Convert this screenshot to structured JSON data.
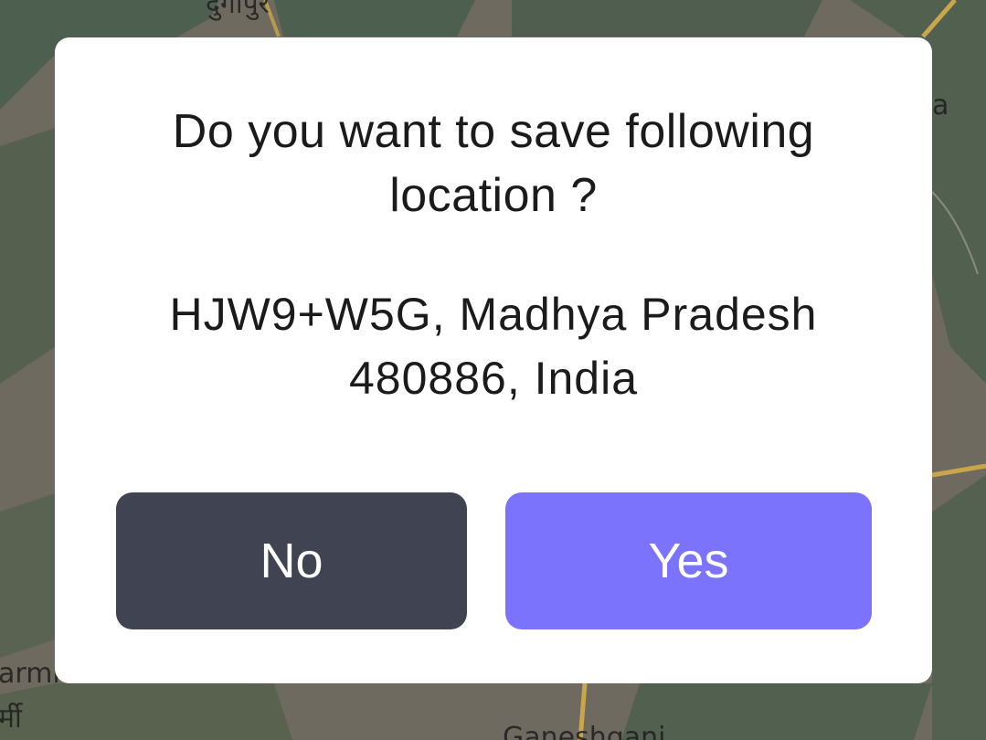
{
  "map": {
    "labels": {
      "top_left_fragment": "दुर्गापुर",
      "right_edge_fragment": "a",
      "bottom_left_fragment_1": "armi",
      "bottom_left_fragment_2": "र्मी",
      "bottom_center_fragment": "Ganeshganj"
    }
  },
  "dialog": {
    "title": "Do you want to save following location ?",
    "address_line_1": "HJW9+W5G, Madhya Pradesh",
    "address_line_2": "480886, India",
    "buttons": {
      "no_label": "No",
      "yes_label": "Yes"
    },
    "colors": {
      "no_button": "#404452",
      "yes_button": "#7b73fb"
    }
  }
}
